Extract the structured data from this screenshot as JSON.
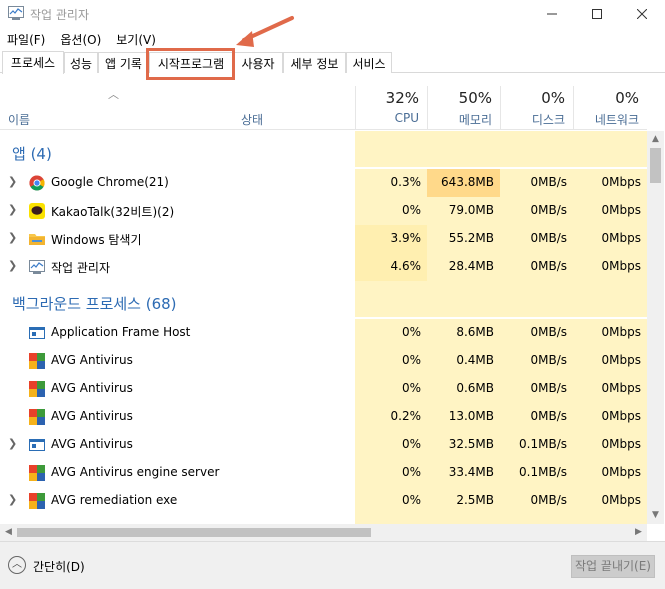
{
  "window": {
    "title": "작업 관리자"
  },
  "menu": {
    "items": [
      "파일(F)",
      "옵션(O)",
      "보기(V)"
    ]
  },
  "tabs": [
    "프로세스",
    "성능",
    "앱 기록",
    "시작프로그램",
    "사용자",
    "세부 정보",
    "서비스"
  ],
  "active_tab": "프로세스",
  "columns": {
    "name": "이름",
    "status": "상태",
    "cpu": {
      "pct": "32%",
      "label": "CPU"
    },
    "memory": {
      "pct": "50%",
      "label": "메모리"
    },
    "disk": {
      "pct": "0%",
      "label": "디스크"
    },
    "network": {
      "pct": "0%",
      "label": "네트워크"
    }
  },
  "groups": {
    "apps": {
      "title": "앱 (4)"
    },
    "background": {
      "title": "백그라운드 프로세스 (68)"
    }
  },
  "app_rows": [
    {
      "name": "Google Chrome(21)",
      "cpu": "0.3%",
      "mem": "643.8MB",
      "disk": "0MB/s",
      "net": "0Mbps",
      "icon": "chrome-icon"
    },
    {
      "name": "KakaoTalk(32비트)(2)",
      "cpu": "0%",
      "mem": "79.0MB",
      "disk": "0MB/s",
      "net": "0Mbps",
      "icon": "kakaotalk-icon"
    },
    {
      "name": "Windows 탐색기",
      "cpu": "3.9%",
      "mem": "55.2MB",
      "disk": "0MB/s",
      "net": "0Mbps",
      "icon": "folder-icon"
    },
    {
      "name": "작업 관리자",
      "cpu": "4.6%",
      "mem": "28.4MB",
      "disk": "0MB/s",
      "net": "0Mbps",
      "icon": "task-manager-icon"
    }
  ],
  "bg_rows": [
    {
      "name": "Application Frame Host",
      "cpu": "0%",
      "mem": "8.6MB",
      "disk": "0MB/s",
      "net": "0Mbps",
      "icon": "app-frame-icon",
      "expandable": false
    },
    {
      "name": "AVG Antivirus",
      "cpu": "0%",
      "mem": "0.4MB",
      "disk": "0MB/s",
      "net": "0Mbps",
      "icon": "avg-icon",
      "expandable": false
    },
    {
      "name": "AVG Antivirus",
      "cpu": "0%",
      "mem": "0.6MB",
      "disk": "0MB/s",
      "net": "0Mbps",
      "icon": "avg-icon",
      "expandable": false
    },
    {
      "name": "AVG Antivirus",
      "cpu": "0.2%",
      "mem": "13.0MB",
      "disk": "0MB/s",
      "net": "0Mbps",
      "icon": "avg-icon",
      "expandable": false
    },
    {
      "name": "AVG Antivirus",
      "cpu": "0%",
      "mem": "32.5MB",
      "disk": "0.1MB/s",
      "net": "0Mbps",
      "icon": "app-frame-icon",
      "expandable": true
    },
    {
      "name": "AVG Antivirus engine server",
      "cpu": "0%",
      "mem": "33.4MB",
      "disk": "0.1MB/s",
      "net": "0Mbps",
      "icon": "avg-icon",
      "expandable": false
    },
    {
      "name": "AVG remediation exe",
      "cpu": "0%",
      "mem": "2.5MB",
      "disk": "0MB/s",
      "net": "0Mbps",
      "icon": "avg-icon",
      "expandable": true
    }
  ],
  "footer": {
    "fewer_details": "간단히(D)",
    "end_task": "작업 끝내기(E)"
  },
  "colors": {
    "accent": "#2d6bb3",
    "annotation": "#e06a4a",
    "heat_low": "#fff4c4",
    "heat_high": "#ffd98a"
  }
}
